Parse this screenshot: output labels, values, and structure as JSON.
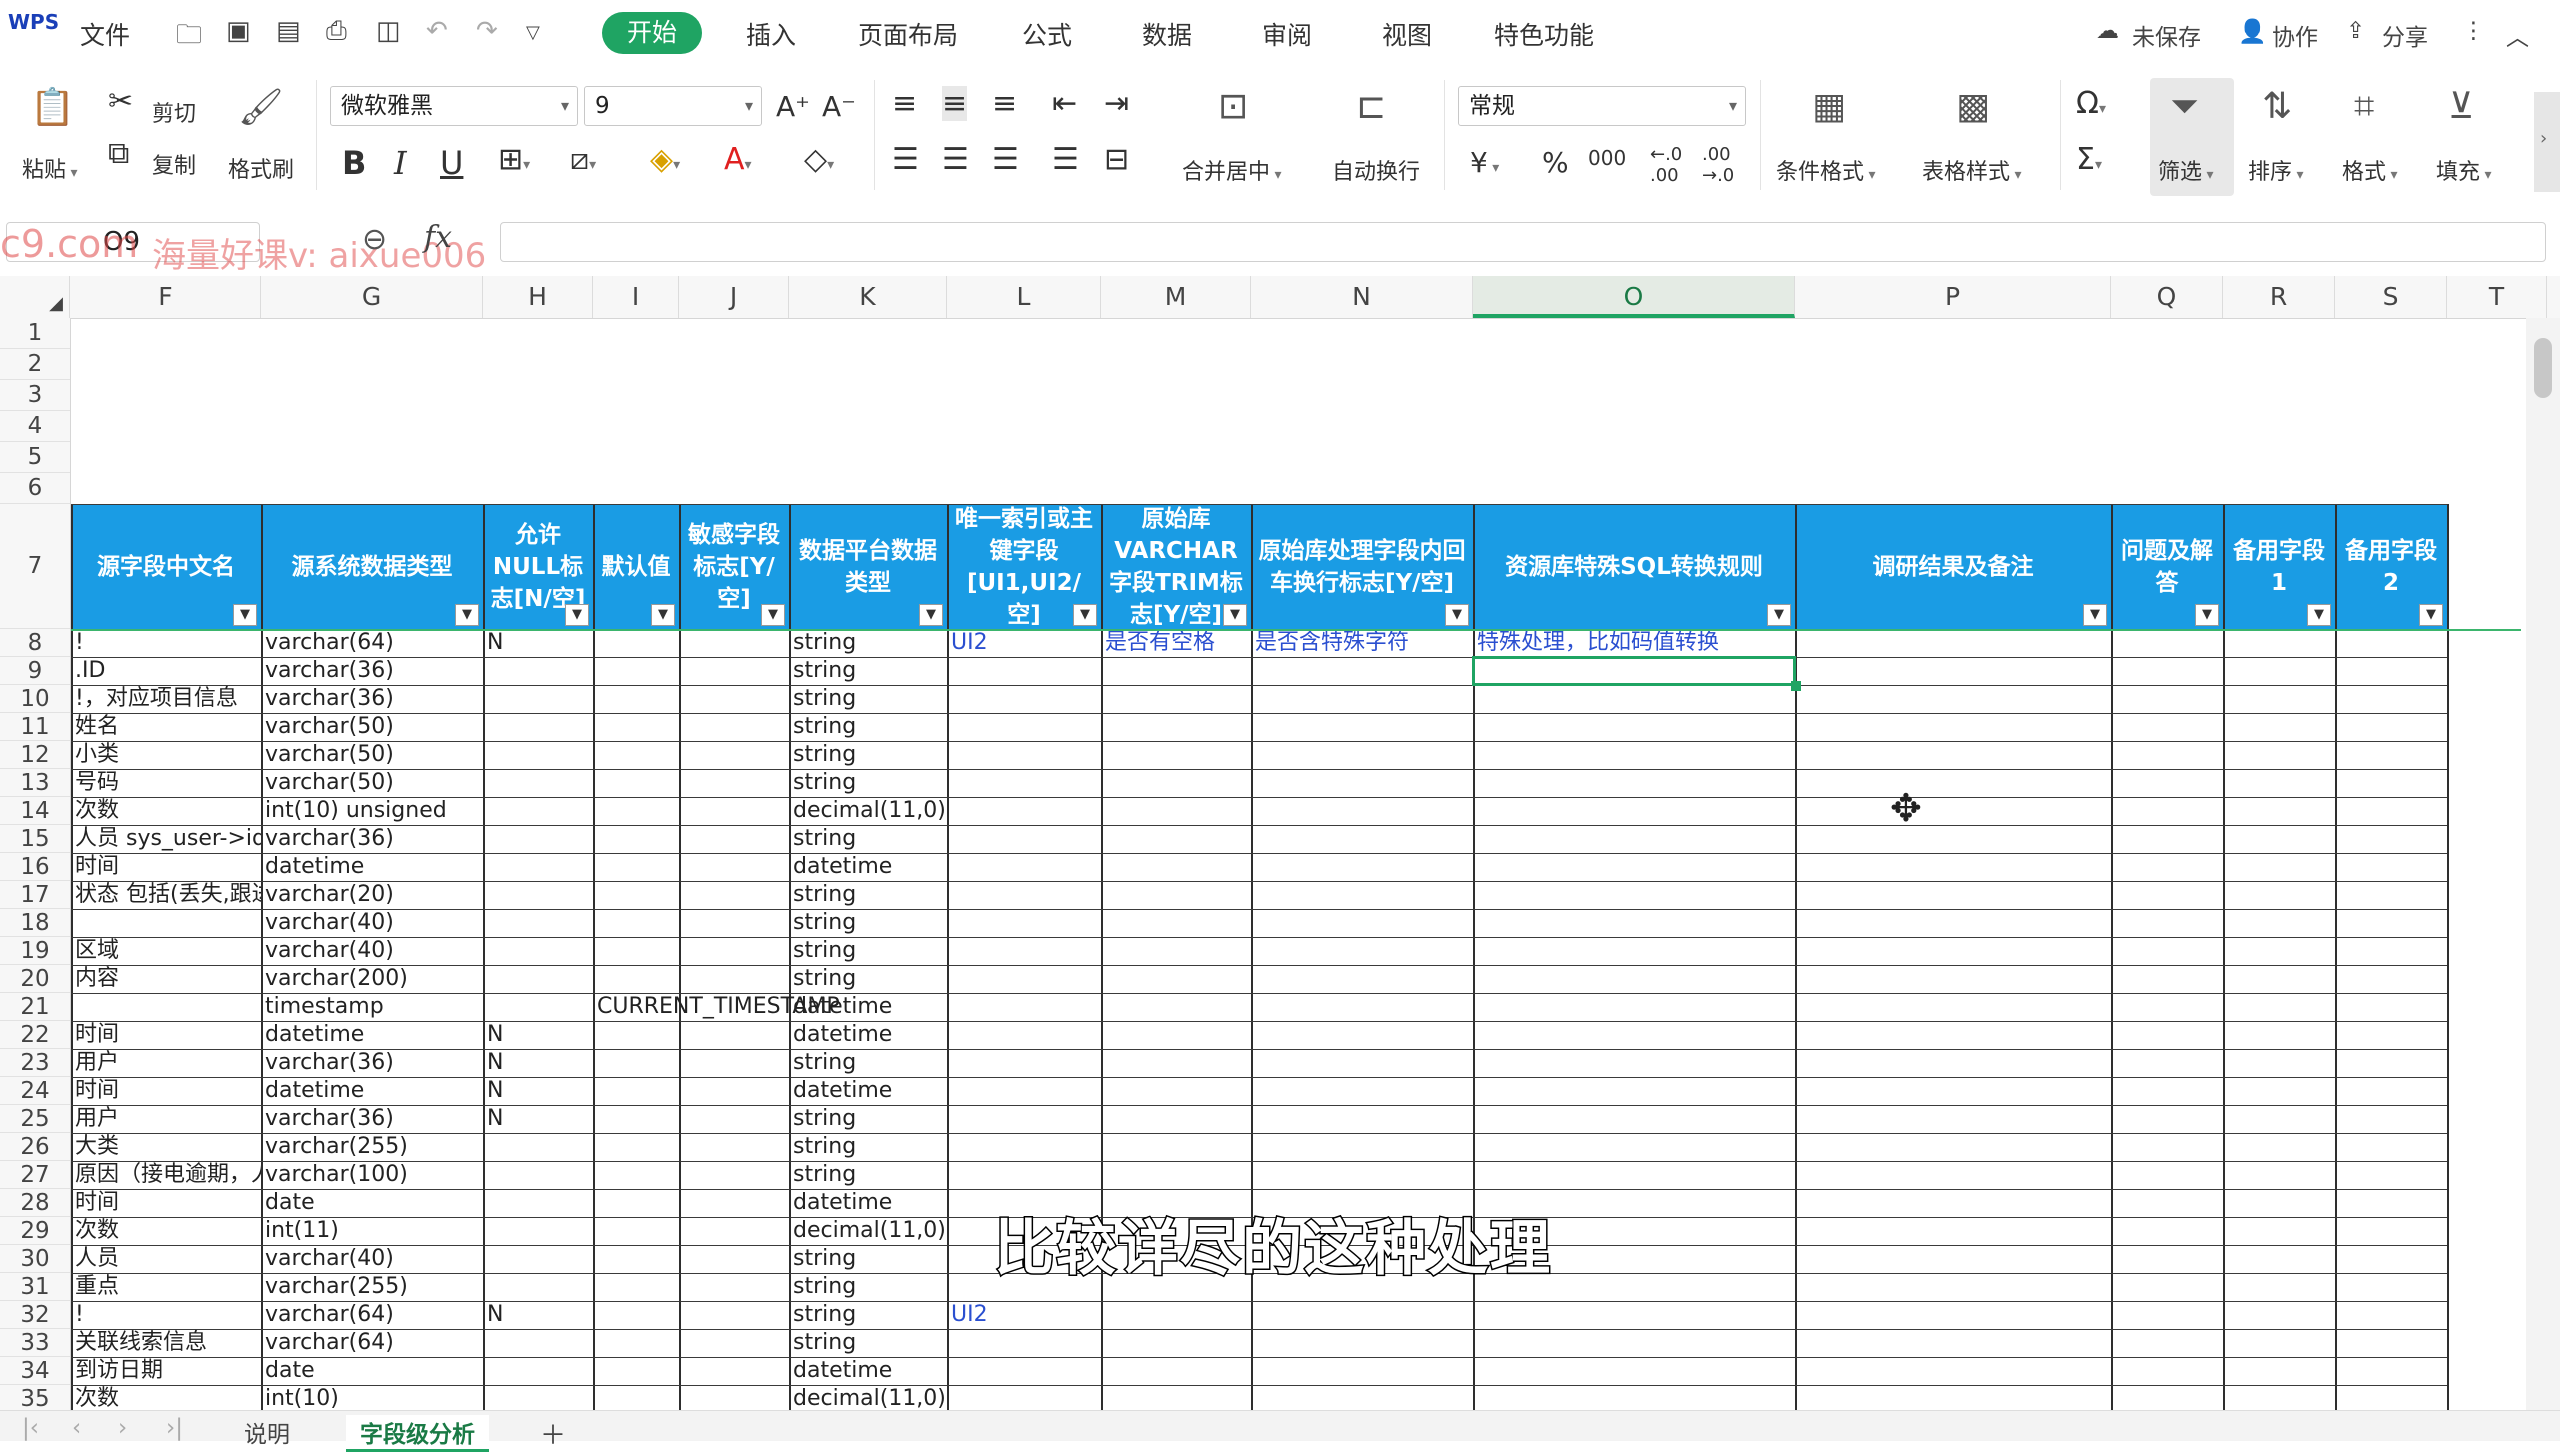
{
  "menubar": {
    "app_mark": "WPS",
    "file": "文件",
    "tabs": [
      "开始",
      "插入",
      "页面布局",
      "公式",
      "数据",
      "审阅",
      "视图",
      "特色功能"
    ],
    "active_tab": "开始",
    "unsaved": "未保存",
    "collab": "协作",
    "share": "分享"
  },
  "ribbon": {
    "paste": "粘贴",
    "cut": "剪切",
    "copy": "复制",
    "format_painter": "格式刷",
    "font_name": "微软雅黑",
    "font_size": "9",
    "merge_center": "合并居中",
    "wrap_text": "自动换行",
    "number_format": "常规",
    "cond_format": "条件格式",
    "table_style": "表格样式",
    "filter": "筛选",
    "sort": "排序",
    "format": "格式",
    "fill": "填充",
    "increase_font": "A⁺",
    "decrease_font": "A⁻",
    "bold": "B",
    "italic": "I",
    "underline": "U",
    "currency": "¥",
    "percent": "%",
    "thousands": "000"
  },
  "formula_bar": {
    "name_box": "O9",
    "fx": "fx",
    "watermark_text": "c9.com",
    "watermark_text2": "海量好课v: aixue006"
  },
  "columns": [
    {
      "letter": "F",
      "w": 190
    },
    {
      "letter": "G",
      "w": 222
    },
    {
      "letter": "H",
      "w": 110
    },
    {
      "letter": "I",
      "w": 86
    },
    {
      "letter": "J",
      "w": 110
    },
    {
      "letter": "K",
      "w": 158
    },
    {
      "letter": "L",
      "w": 154
    },
    {
      "letter": "M",
      "w": 150
    },
    {
      "letter": "N",
      "w": 222
    },
    {
      "letter": "O",
      "w": 322
    },
    {
      "letter": "P",
      "w": 316
    },
    {
      "letter": "Q",
      "w": 112
    },
    {
      "letter": "R",
      "w": 112
    },
    {
      "letter": "S",
      "w": 112
    },
    {
      "letter": "T",
      "w": 100
    }
  ],
  "selected_column": "O",
  "header_row": [
    "源字段中文名",
    "源系统数据类型",
    "允许NULL标志[N/空]",
    "默认值",
    "敏感字段标志[Y/空]",
    "数据平台数据类型",
    "唯一索引或主键字段[UI1,UI2/空]",
    "原始库VARCHAR字段TRIM标志[Y/空]",
    "原始库处理字段内回车换行标志[Y/空]",
    "资源库特殊SQL转换规则",
    "调研结果及备注",
    "问题及解答",
    "备用字段1",
    "备用字段2"
  ],
  "row_numbers": [
    "1",
    "2",
    "3",
    "4",
    "5",
    "6",
    "7",
    "8",
    "9",
    "10",
    "11",
    "12",
    "13",
    "14",
    "15",
    "16",
    "17",
    "18",
    "19",
    "20",
    "21",
    "22",
    "23",
    "24",
    "25",
    "26",
    "27",
    "28",
    "29",
    "30",
    "31",
    "32",
    "33",
    "34",
    "35"
  ],
  "data_rows": [
    [
      "!",
      "varchar(64)",
      "N",
      "",
      "",
      "string",
      "UI2",
      "是否有空格",
      "是否含特殊字符",
      "特殊处理，比如码值转换"
    ],
    [
      ".ID",
      "varchar(36)",
      "",
      "",
      "",
      "string",
      "",
      "",
      "",
      ""
    ],
    [
      "!，对应项目信息",
      "varchar(36)",
      "",
      "",
      "",
      "string",
      "",
      "",
      "",
      ""
    ],
    [
      "姓名",
      "varchar(50)",
      "",
      "",
      "",
      "string",
      "",
      "",
      "",
      ""
    ],
    [
      "小类",
      "varchar(50)",
      "",
      "",
      "",
      "string",
      "",
      "",
      "",
      ""
    ],
    [
      "号码",
      "varchar(50)",
      "",
      "",
      "",
      "string",
      "",
      "",
      "",
      ""
    ],
    [
      "次数",
      "int(10) unsigned",
      "",
      "",
      "",
      "decimal(11,0)",
      "",
      "",
      "",
      ""
    ],
    [
      "人员 sys_user->id",
      "varchar(36)",
      "",
      "",
      "",
      "string",
      "",
      "",
      "",
      ""
    ],
    [
      "时间",
      "datetime",
      "",
      "",
      "",
      "datetime",
      "",
      "",
      "",
      ""
    ],
    [
      "状态 包括(丢失,跟进",
      "varchar(20)",
      "",
      "",
      "",
      "string",
      "",
      "",
      "",
      ""
    ],
    [
      "",
      "varchar(40)",
      "",
      "",
      "",
      "string",
      "",
      "",
      "",
      ""
    ],
    [
      "区域",
      "varchar(40)",
      "",
      "",
      "",
      "string",
      "",
      "",
      "",
      ""
    ],
    [
      "内容",
      "varchar(200)",
      "",
      "",
      "",
      "string",
      "",
      "",
      "",
      ""
    ],
    [
      "",
      "timestamp",
      "",
      "CURRENT_TIMESTAMP",
      "",
      "datetime",
      "",
      "",
      "",
      ""
    ],
    [
      "时间",
      "datetime",
      "N",
      "",
      "",
      "datetime",
      "",
      "",
      "",
      ""
    ],
    [
      "用户",
      "varchar(36)",
      "N",
      "",
      "",
      "string",
      "",
      "",
      "",
      ""
    ],
    [
      "时间",
      "datetime",
      "N",
      "",
      "",
      "datetime",
      "",
      "",
      "",
      ""
    ],
    [
      "用户",
      "varchar(36)",
      "N",
      "",
      "",
      "string",
      "",
      "",
      "",
      ""
    ],
    [
      "大类",
      "varchar(255)",
      "",
      "",
      "",
      "string",
      "",
      "",
      "",
      ""
    ],
    [
      "原因（接电逾期，人",
      "varchar(100)",
      "",
      "",
      "",
      "string",
      "",
      "",
      "",
      ""
    ],
    [
      "时间",
      "date",
      "",
      "",
      "",
      "datetime",
      "",
      "",
      "",
      ""
    ],
    [
      "次数",
      "int(11)",
      "",
      "",
      "",
      "decimal(11,0)",
      "",
      "",
      "",
      ""
    ],
    [
      "人员",
      "varchar(40)",
      "",
      "",
      "",
      "string",
      "",
      "",
      "",
      ""
    ],
    [
      "重点",
      "varchar(255)",
      "",
      "",
      "",
      "string",
      "",
      "",
      "",
      ""
    ],
    [
      "!",
      "varchar(64)",
      "N",
      "",
      "",
      "string",
      "UI2",
      "",
      "",
      ""
    ],
    [
      "关联线索信息",
      "varchar(64)",
      "",
      "",
      "",
      "string",
      "",
      "",
      "",
      ""
    ],
    [
      "到访日期",
      "date",
      "",
      "",
      "",
      "datetime",
      "",
      "",
      "",
      ""
    ],
    [
      "次数",
      "int(10)",
      "",
      "",
      "",
      "decimal(11,0)",
      "",
      "",
      "",
      ""
    ]
  ],
  "subtitle": "比较详尽的这种处理",
  "sheet_tabs": [
    "说明",
    "字段级分析"
  ],
  "active_sheet": "字段级分析",
  "colors": {
    "accent": "#1fa463",
    "header_fill": "#1a9ce4",
    "blue_text": "#2a4fd0"
  }
}
